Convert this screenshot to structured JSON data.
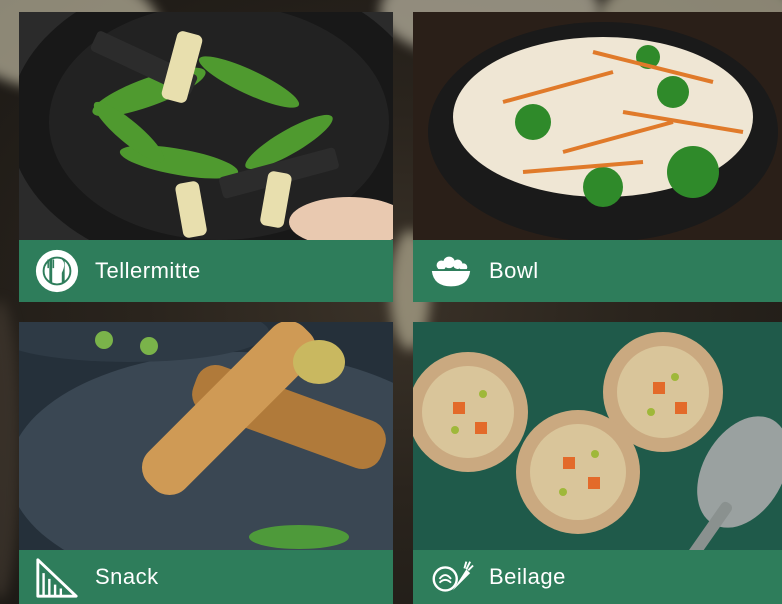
{
  "tiles": [
    {
      "label": "Tellermitte",
      "icon": "plate-cutlery-icon"
    },
    {
      "label": "Bowl",
      "icon": "salad-bowl-icon"
    },
    {
      "label": "Snack",
      "icon": "sandwich-snack-icon"
    },
    {
      "label": "Beilage",
      "icon": "vegetables-icon"
    }
  ],
  "colors": {
    "accent": "#2e7d5b"
  }
}
